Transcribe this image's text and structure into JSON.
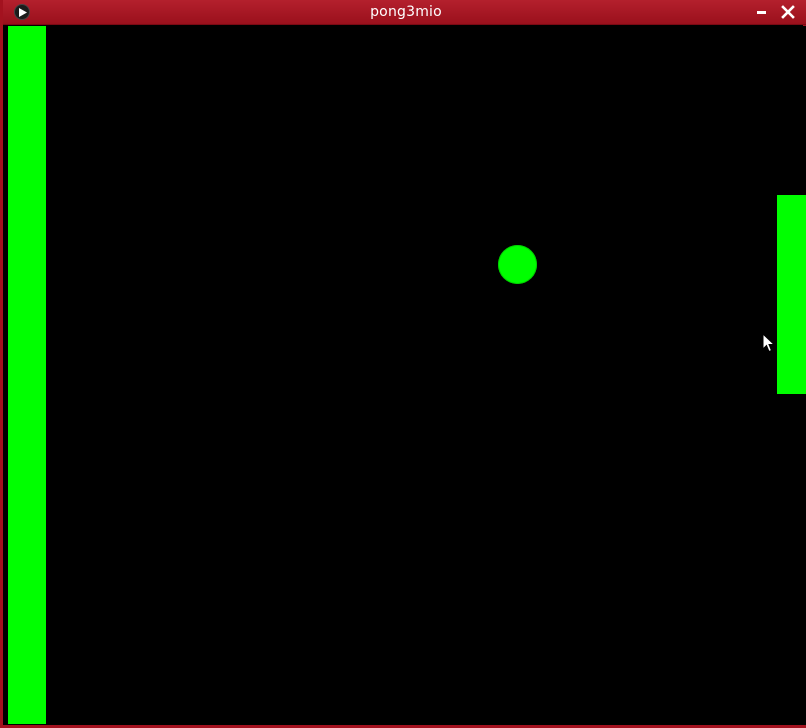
{
  "window": {
    "title": "pong3mio",
    "frame_color": "#a3121f"
  },
  "titlebar": {
    "app_icon": "play-icon",
    "minimize_icon": "minimize-icon",
    "close_icon": "close-icon"
  },
  "game": {
    "background_color": "#000000",
    "object_color": "#00ff00"
  }
}
